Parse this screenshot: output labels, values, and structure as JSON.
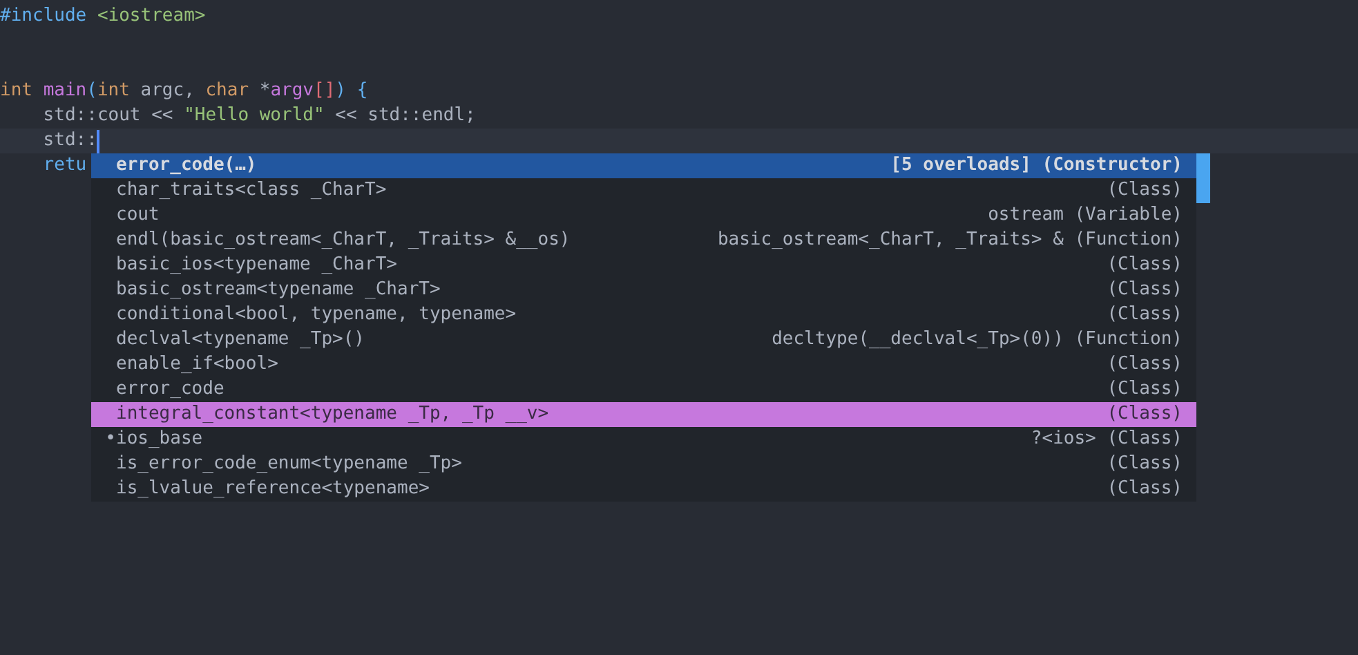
{
  "editor": {
    "lines": [
      {
        "tokens": [
          {
            "text": "#include ",
            "kind": "keyword"
          },
          {
            "text": "<iostream>",
            "kind": "string"
          }
        ],
        "cursor": false
      },
      {
        "cursor": false
      },
      {
        "cursor": false
      },
      {
        "tokens": [
          {
            "text": "int ",
            "kind": "type"
          },
          {
            "text": "main",
            "kind": "function"
          },
          {
            "text": "(",
            "kind": "punct"
          },
          {
            "text": "int",
            "kind": "type"
          },
          {
            "text": " argc, ",
            "kind": "plain"
          },
          {
            "text": "char",
            "kind": "type"
          },
          {
            "text": " *",
            "kind": "plain"
          },
          {
            "text": "argv",
            "kind": "function"
          },
          {
            "text": "[]",
            "kind": "bracket"
          },
          {
            "text": ") {",
            "kind": "punct"
          }
        ],
        "cursor": false
      },
      {
        "tokens": [
          {
            "text": "    std::cout << ",
            "kind": "plain"
          },
          {
            "text": "\"Hello world\"",
            "kind": "string"
          },
          {
            "text": " << std::endl;",
            "kind": "plain"
          }
        ],
        "cursor": false
      },
      {
        "tokens": [
          {
            "text": "    std::",
            "kind": "plain"
          }
        ],
        "cursor": true
      },
      {
        "tokens": [
          {
            "text": "    retu",
            "kind": "keyword"
          }
        ],
        "cursor": false
      }
    ]
  },
  "completion": {
    "items": [
      {
        "label": "error_code(…)",
        "detail": "[5 overloads] (Constructor)",
        "selected": true,
        "marked": false
      },
      {
        "label": "char_traits<class _CharT>",
        "detail": "(Class)",
        "selected": false,
        "marked": false
      },
      {
        "label": "cout",
        "detail": "ostream (Variable)",
        "selected": false,
        "marked": false
      },
      {
        "label": "endl(basic_ostream<_CharT, _Traits> &__os)",
        "detail": "basic_ostream<_CharT, _Traits> & (Function)",
        "selected": false,
        "marked": false
      },
      {
        "label": "basic_ios<typename _CharT>",
        "detail": "(Class)",
        "selected": false,
        "marked": false
      },
      {
        "label": "basic_ostream<typename _CharT>",
        "detail": "(Class)",
        "selected": false,
        "marked": false
      },
      {
        "label": "conditional<bool, typename, typename>",
        "detail": "(Class)",
        "selected": false,
        "marked": false
      },
      {
        "label": "declval<typename _Tp>()",
        "detail": "decltype(__declval<_Tp>(0)) (Function)",
        "selected": false,
        "marked": false
      },
      {
        "label": "enable_if<bool>",
        "detail": "(Class)",
        "selected": false,
        "marked": false
      },
      {
        "label": "error_code",
        "detail": "(Class)",
        "selected": false,
        "marked": false
      },
      {
        "label": "integral_constant<typename _Tp, _Tp __v>",
        "detail": "(Class)",
        "selected": false,
        "marked": true
      },
      {
        "label": "ios_base",
        "detail": "?<ios> (Class)",
        "selected": false,
        "marked": false,
        "bullet": "•"
      },
      {
        "label": "is_error_code_enum<typename _Tp>",
        "detail": "(Class)",
        "selected": false,
        "marked": false
      },
      {
        "label": "is_lvalue_reference<typename>",
        "detail": "(Class)",
        "selected": false,
        "marked": false
      }
    ]
  }
}
